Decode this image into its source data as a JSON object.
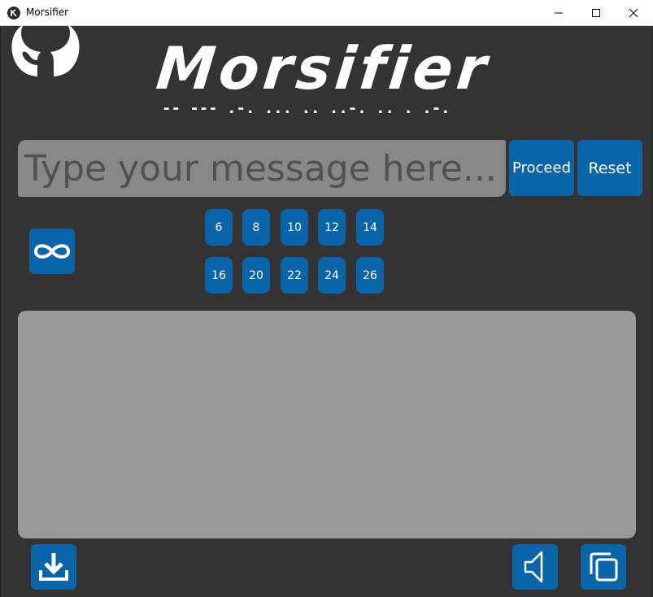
{
  "window": {
    "title": "Morsifier"
  },
  "header": {
    "logo_text": "Morsifier",
    "morse_text": "-- --- .-. ... .. ..-. .. . .-."
  },
  "input": {
    "placeholder": "Type your message here...",
    "value": ""
  },
  "buttons": {
    "proceed": "Proceed",
    "reset": "Reset"
  },
  "size_options": [
    "6",
    "8",
    "10",
    "12",
    "14",
    "16",
    "20",
    "22",
    "24",
    "26"
  ],
  "output": {
    "text": ""
  },
  "icons": [
    "github-icon",
    "infinity-icon",
    "download-icon",
    "speaker-icon",
    "copy-icon",
    "minimize-icon",
    "maximize-icon",
    "close-icon"
  ],
  "colors": {
    "background": "#333333",
    "accent": "#0b63a8",
    "input_bg": "#888888",
    "output_bg": "#999999"
  }
}
